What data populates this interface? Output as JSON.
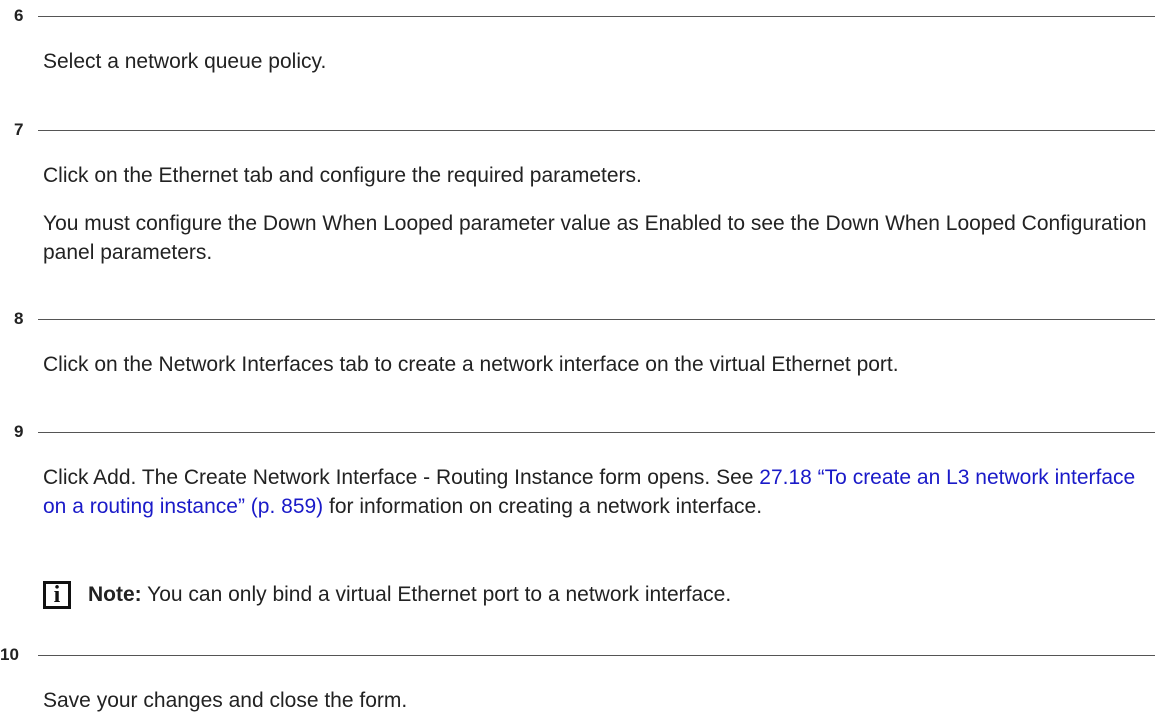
{
  "steps": [
    {
      "number": "6",
      "paragraphs": [
        "Select a network queue policy."
      ]
    },
    {
      "number": "7",
      "paragraphs": [
        "Click on the Ethernet tab and configure the required parameters.",
        "You must configure the Down When Looped parameter value as Enabled to see the Down When Looped Configuration panel parameters."
      ]
    },
    {
      "number": "8",
      "paragraphs": [
        "Click on the Network Interfaces tab to create a network interface on the virtual Ethernet port."
      ]
    },
    {
      "number": "9",
      "paragraph_pre": "Click Add. The Create Network Interface - Routing Instance form opens. See ",
      "link_text": "27.18 “To create an L3 network interface on a routing instance” (p. 859)",
      "paragraph_post": " for information on creating a network interface.",
      "note_label": "Note:",
      "note_text": " You can only bind a virtual Ethernet port to a network interface.",
      "note_icon": "info-icon"
    },
    {
      "number": "10",
      "paragraphs": [
        "Save your changes and close the form."
      ]
    }
  ],
  "colors": {
    "text": "#222222",
    "link": "#1a1ac8",
    "rule": "#555555"
  }
}
